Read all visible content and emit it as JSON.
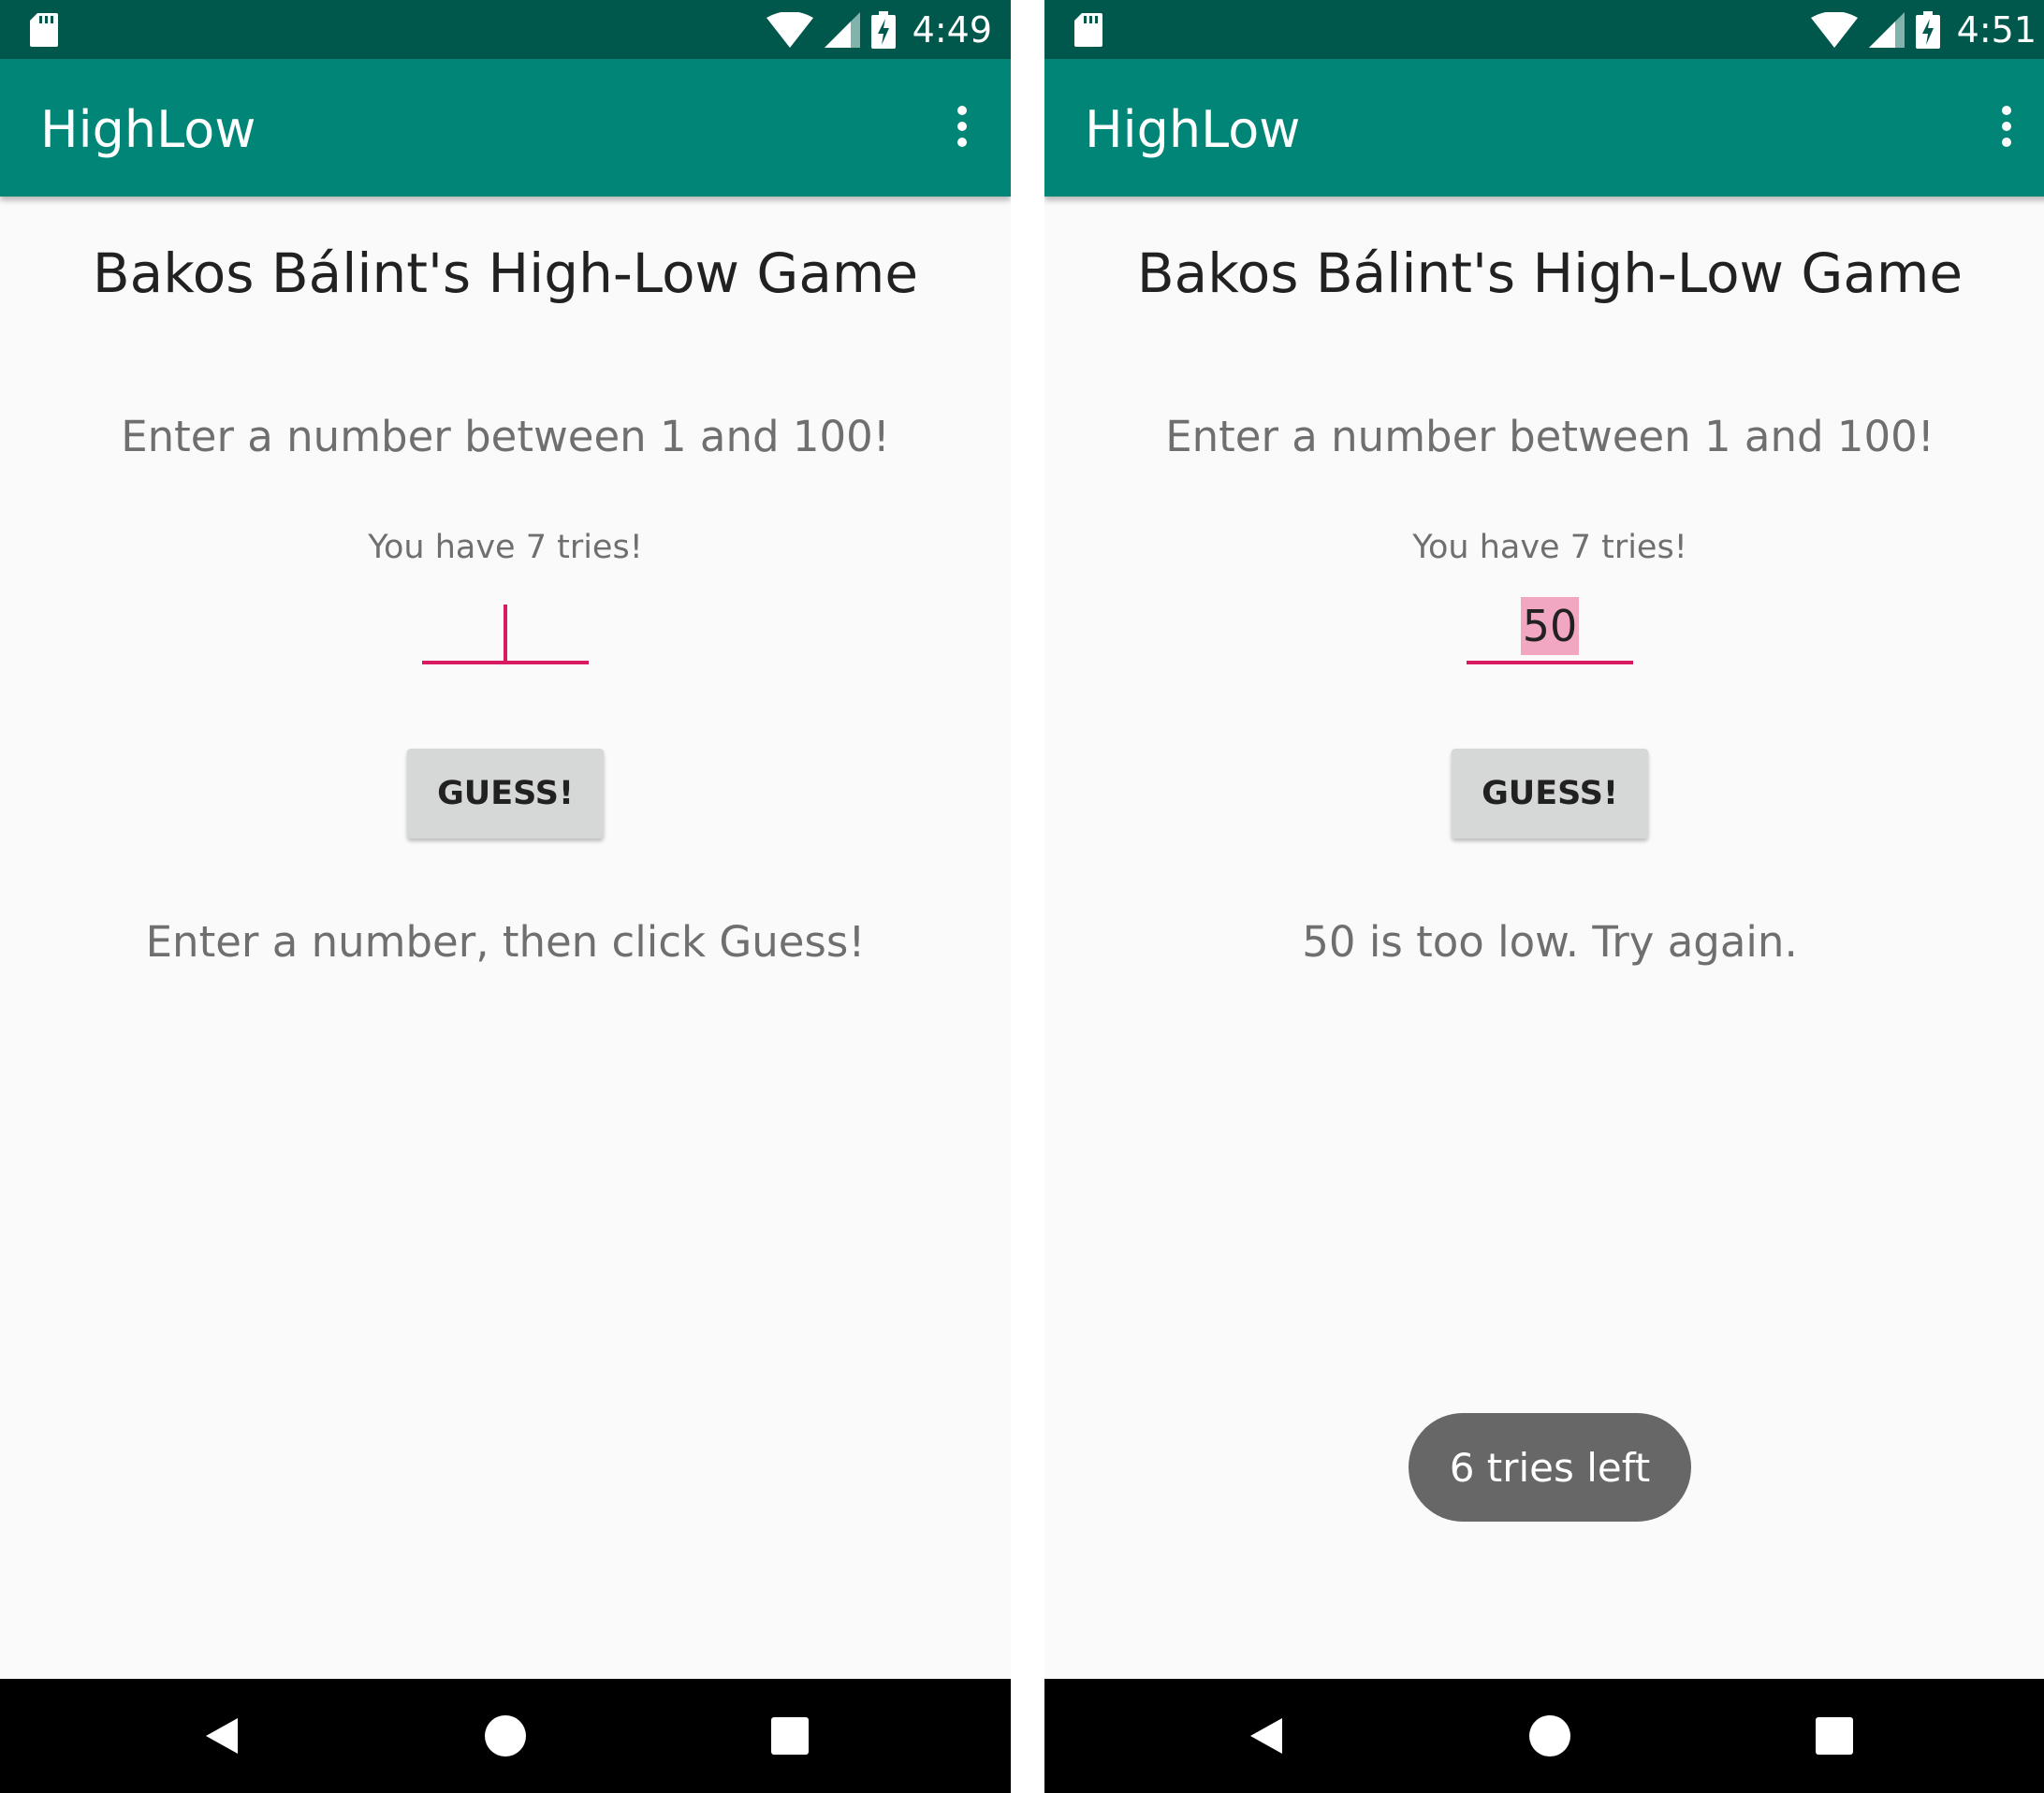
{
  "screens": [
    {
      "status_time": "4:49",
      "app_title": "HighLow",
      "heading": "Bakos Bálint's High-Low Game",
      "instruction": "Enter a number between 1 and 100!",
      "tries_label": "You have 7 tries!",
      "input_value": "",
      "guess_button_label": "GUESS!",
      "message": "Enter a number, then click Guess!"
    },
    {
      "status_time": "4:51",
      "app_title": "HighLow",
      "heading": "Bakos Bálint's High-Low Game",
      "instruction": "Enter a number between 1 and 100!",
      "tries_label": "You have 7 tries!",
      "input_value": "50",
      "guess_button_label": "GUESS!",
      "message": "50 is too low. Try again.",
      "toast": "6 tries left"
    }
  ],
  "colors": {
    "status_bar": "#00574b",
    "app_bar": "#008577",
    "accent": "#d81b60",
    "selection": "#f1a7c2",
    "button": "#d6d7d7",
    "toast": "#676767"
  },
  "icons": [
    "sd-card-icon",
    "wifi-icon",
    "cell-signal-icon",
    "battery-charging-icon",
    "overflow-menu-icon",
    "back-icon",
    "home-icon",
    "recents-icon"
  ]
}
